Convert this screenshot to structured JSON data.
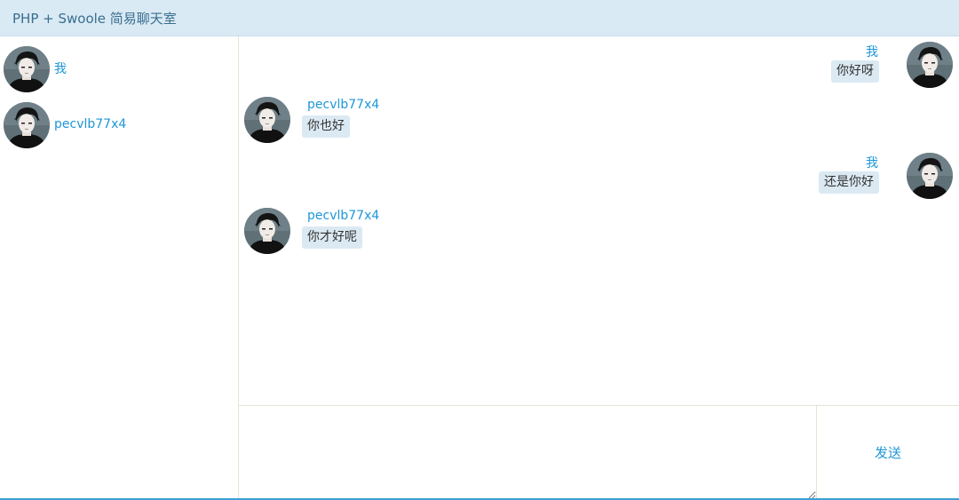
{
  "header": {
    "title": "PHP + Swoole 简易聊天室"
  },
  "sidebar": {
    "users": [
      {
        "name": "我",
        "avatar": "avatar-portrait"
      },
      {
        "name": "pecvlb77x4",
        "avatar": "avatar-portrait"
      }
    ]
  },
  "messages": [
    {
      "from": "self",
      "name": "我",
      "text": "你好呀"
    },
    {
      "from": "other",
      "name": "pecvlb77x4",
      "text": "你也好"
    },
    {
      "from": "self",
      "name": "我",
      "text": "还是你好"
    },
    {
      "from": "other",
      "name": "pecvlb77x4",
      "text": "你才好呢"
    }
  ],
  "composer": {
    "value": "",
    "send_label": "发送"
  },
  "colors": {
    "accent": "#1e96d8",
    "header_bg": "#d9eaf4",
    "bubble_bg": "#dbe9f3",
    "border": "#e2e6d4"
  }
}
